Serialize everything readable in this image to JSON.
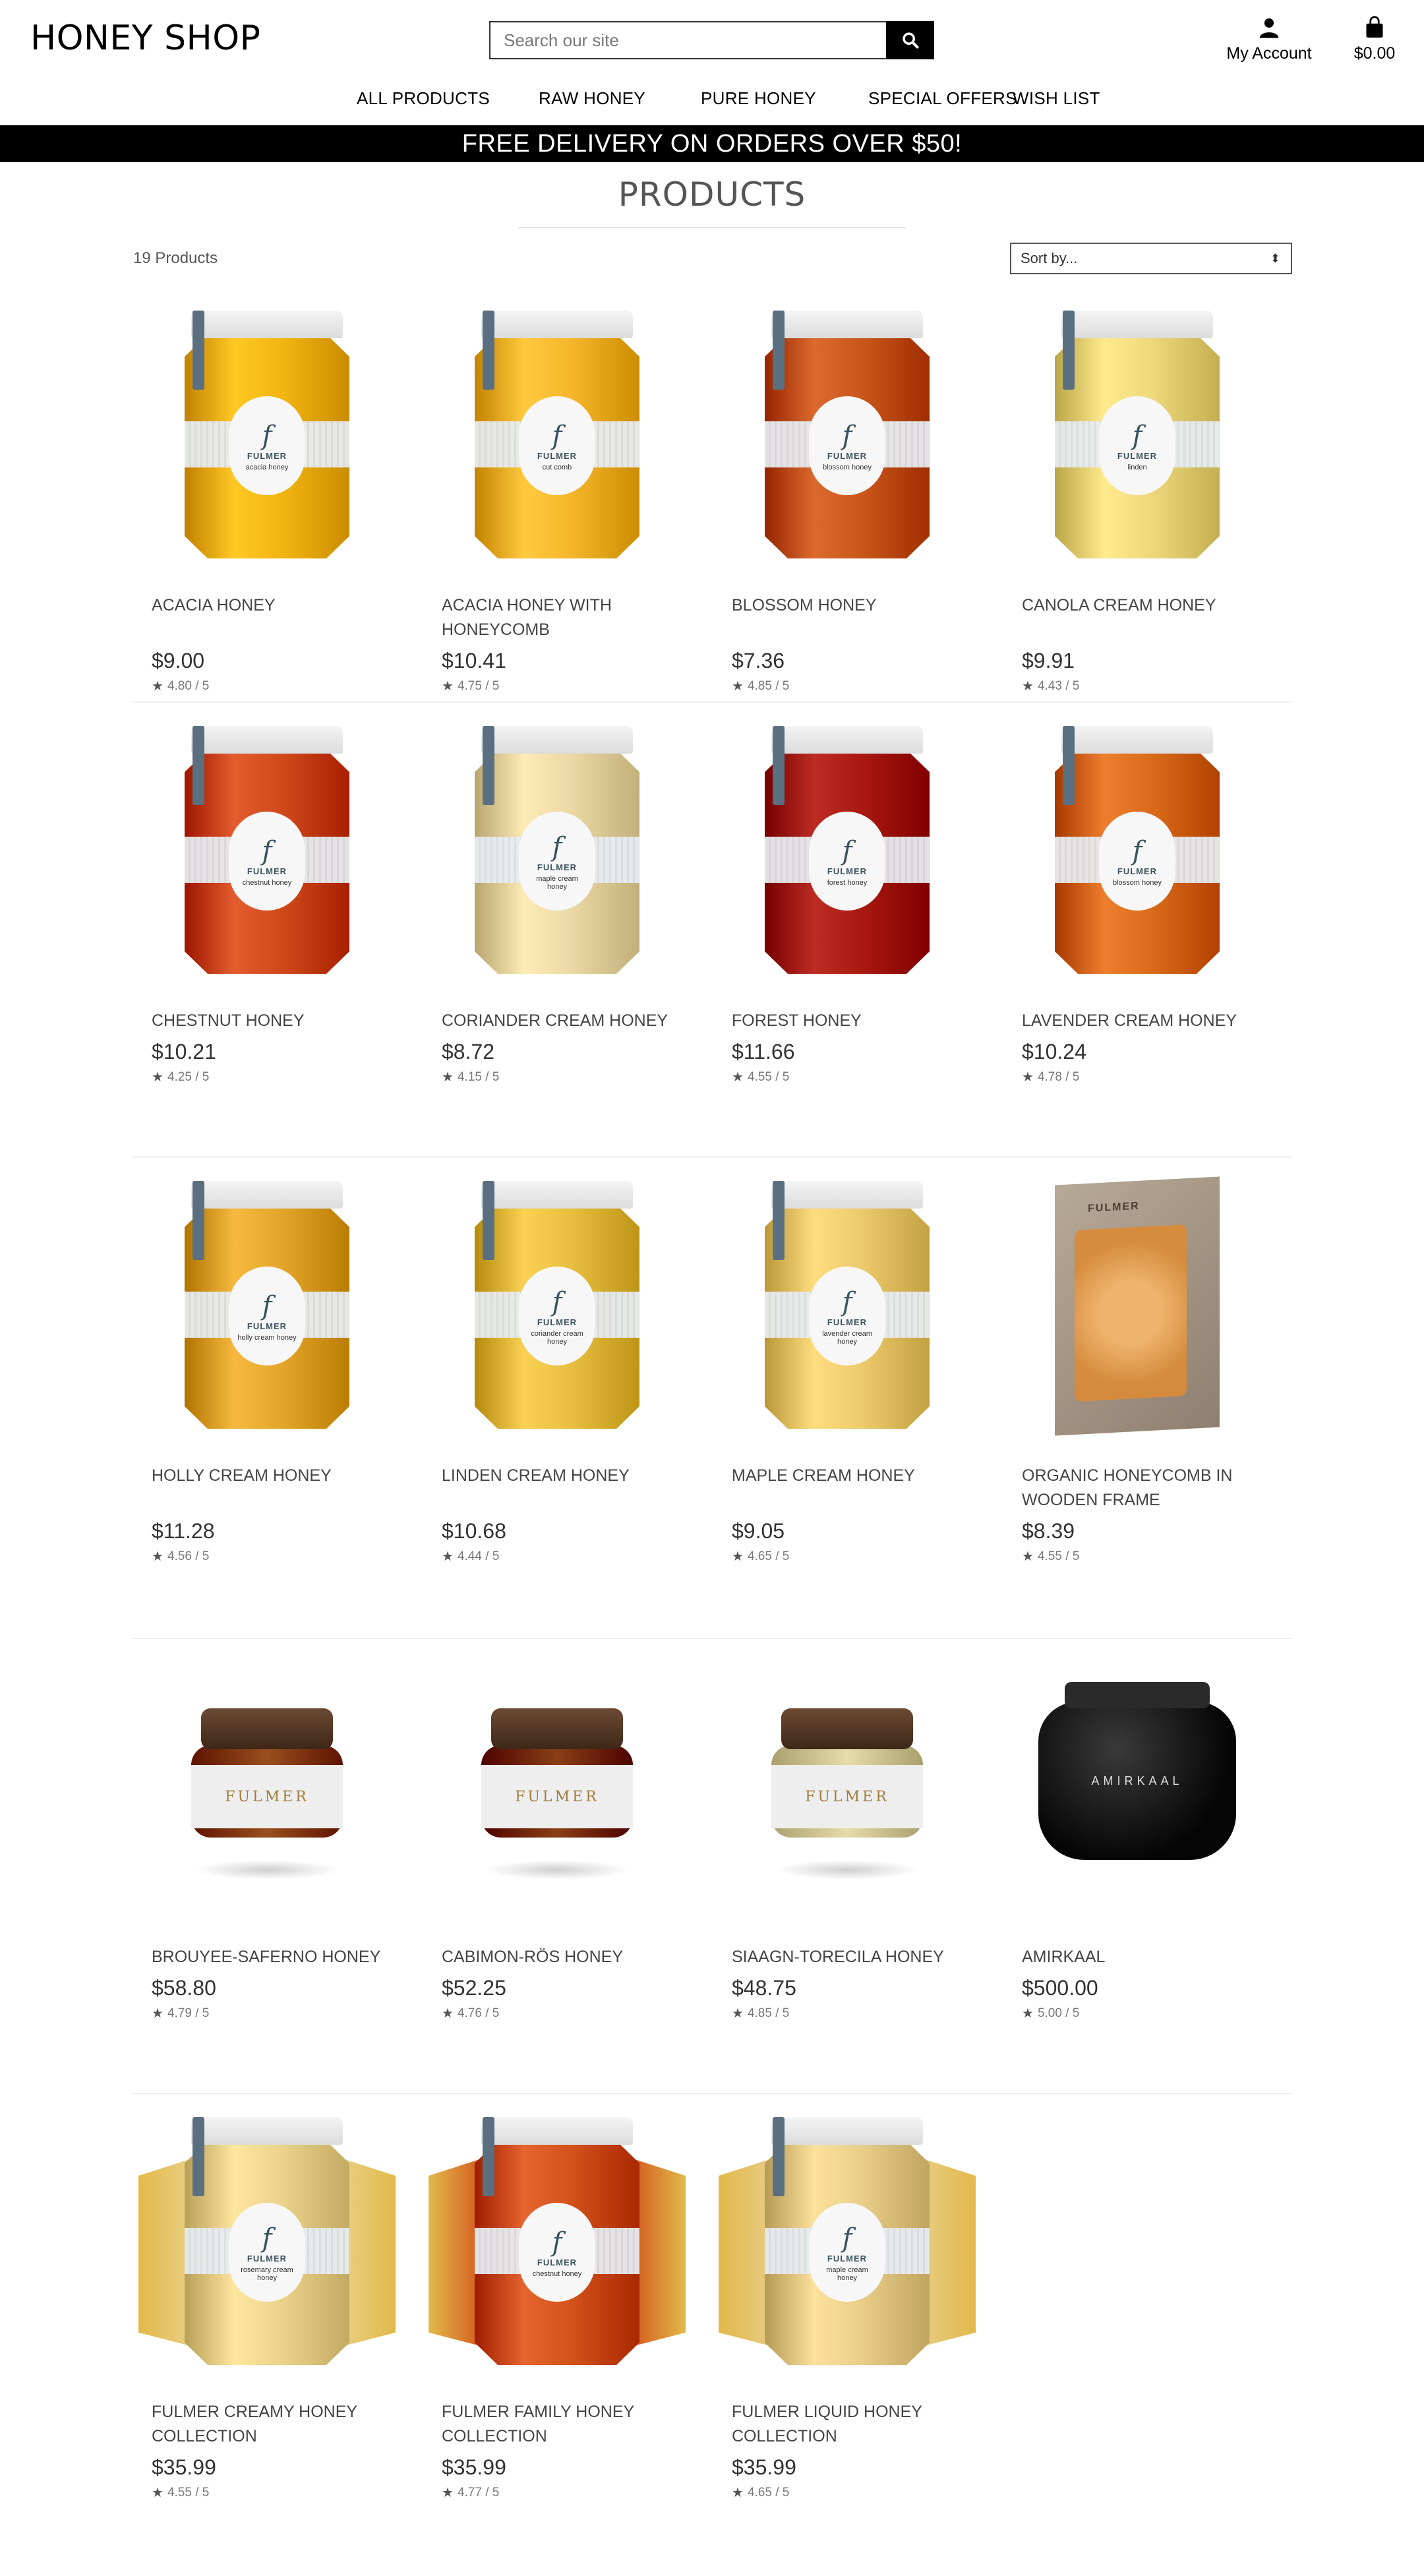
{
  "site": {
    "logo": "HONEY SHOP",
    "search_placeholder": "Search our site",
    "account_label": "My Account",
    "cart_total": "$0.00"
  },
  "nav": [
    "ALL PRODUCTS",
    "RAW HONEY",
    "PURE HONEY",
    "SPECIAL OFFERS",
    "WISH LIST"
  ],
  "banner": "FREE DELIVERY ON ORDERS OVER $50!",
  "page_title": "PRODUCTS",
  "product_count": "19 Products",
  "sort_label": "Sort by...",
  "products": [
    {
      "name": "ACACIA HONEY",
      "price": "$9.00",
      "rating": "4.80 / 5",
      "img": "jar",
      "color": "#f2b410",
      "label": "acacia honey"
    },
    {
      "name": "ACACIA HONEY WITH HONEYCOMB",
      "price": "$10.41",
      "rating": "4.75 / 5",
      "img": "jar",
      "color": "#f5b52a",
      "label": "cut comb"
    },
    {
      "name": "BLOSSOM HONEY",
      "price": "$7.36",
      "rating": "4.85 / 5",
      "img": "jar",
      "color": "#c8561a",
      "label": "blossom honey"
    },
    {
      "name": "CANOLA CREAM HONEY",
      "price": "$9.91",
      "rating": "4.43 / 5",
      "img": "jar",
      "color": "#ecd77a",
      "label": "linden"
    },
    {
      "name": "CHESTNUT HONEY",
      "price": "$10.21",
      "rating": "4.25 / 5",
      "img": "jar",
      "color": "#d0481a",
      "label": "chestnut honey"
    },
    {
      "name": "CORIANDER CREAM HONEY",
      "price": "$8.72",
      "rating": "4.15 / 5",
      "img": "jar",
      "color": "#ead7a2",
      "label": "maple cream honey"
    },
    {
      "name": "FOREST HONEY",
      "price": "$11.66",
      "rating": "4.55 / 5",
      "img": "jar",
      "color": "#a8180f",
      "label": "forest honey"
    },
    {
      "name": "LAVENDER CREAM HONEY",
      "price": "$10.24",
      "rating": "4.78 / 5",
      "img": "jar",
      "color": "#d96a1a",
      "label": "blossom honey"
    },
    {
      "name": "HOLLY CREAM HONEY",
      "price": "$11.28",
      "rating": "4.56 / 5",
      "img": "jar",
      "color": "#e2a52a",
      "label": "holly cream honey"
    },
    {
      "name": "LINDEN CREAM HONEY",
      "price": "$10.68",
      "rating": "4.44 / 5",
      "img": "jar",
      "color": "#e6bd3f",
      "label": "coriander cream honey"
    },
    {
      "name": "MAPLE CREAM HONEY",
      "price": "$9.05",
      "rating": "4.65 / 5",
      "img": "jar",
      "color": "#ecc96a",
      "label": "lavender cream honey"
    },
    {
      "name": "ORGANIC HONEYCOMB IN WOODEN FRAME",
      "price": "$8.39",
      "rating": "4.55 / 5",
      "img": "box",
      "color": "#a89886",
      "label": "FULMER"
    },
    {
      "name": "BROUYEE-SAFERNO HONEY",
      "price": "$58.80",
      "rating": "4.79 / 5",
      "img": "pot",
      "color": "#9a4f1f",
      "label": "FULMER"
    },
    {
      "name": "CABIMON-RÖS HONEY",
      "price": "$52.25",
      "rating": "4.76 / 5",
      "img": "pot",
      "color": "#8a3f17",
      "label": "FULMER"
    },
    {
      "name": "SIAAGN-TORECILA HONEY",
      "price": "$48.75",
      "rating": "4.85 / 5",
      "img": "pot",
      "color": "#e6dcaa",
      "label": "FULMER"
    },
    {
      "name": "AMIRKAAL",
      "price": "$500.00",
      "rating": "5.00 / 5",
      "img": "blackpot",
      "color": "#050505",
      "label": "AMIRKAAL"
    },
    {
      "name": "FULMER CREAMY HONEY COLLECTION",
      "price": "$35.99",
      "rating": "4.55 / 5",
      "img": "collection",
      "color": "#ead28a",
      "label": "rosemary cream honey"
    },
    {
      "name": "FULMER FAMILY HONEY COLLECTION",
      "price": "$35.99",
      "rating": "4.77 / 5",
      "img": "collection",
      "color": "#d2501a",
      "label": "chestnut honey"
    },
    {
      "name": "FULMER LIQUID HONEY COLLECTION",
      "price": "$35.99",
      "rating": "4.65 / 5",
      "img": "collection",
      "color": "#e8cd88",
      "label": "maple cream honey"
    }
  ],
  "brand_mark": "FULMER"
}
